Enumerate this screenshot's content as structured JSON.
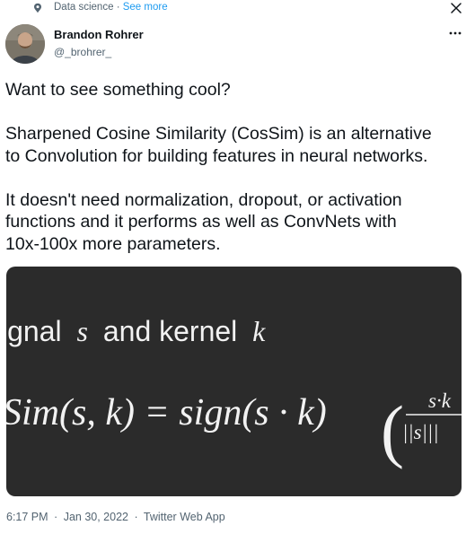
{
  "topic": {
    "label": "Data science",
    "separator": "·",
    "see_more": "See more",
    "icon": "topic-pin-icon"
  },
  "actions": {
    "close_icon": "close-icon",
    "more_icon": "more-dots-icon"
  },
  "author": {
    "name": "Brandon Rohrer",
    "handle": "@_brohrer_"
  },
  "tweet": {
    "paragraphs": [
      "Want to see something cool?",
      "Sharpened Cosine Similarity (CosSim) is an alternative\nto Convolution for building features in neural networks.",
      "It doesn't need normalization, dropout, or activation\nfunctions and it performs as well as ConvNets with\n10x-100x more parameters."
    ]
  },
  "media": {
    "line1_prefix": "ignal",
    "line1_s": "s",
    "line1_mid": "and kernel",
    "line1_k": "k",
    "formula_left": "Sim(s, k) = sign(s · k)",
    "frac_num": "s·k",
    "frac_den": "||s|||",
    "colors": {
      "background": "#2b2b2b",
      "text": "#f2f2f2"
    }
  },
  "meta": {
    "time": "6:17 PM",
    "date": "Jan 30, 2022",
    "source": "Twitter Web App",
    "separator": "·"
  }
}
